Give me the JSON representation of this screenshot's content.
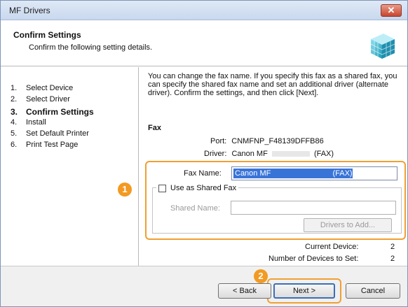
{
  "window": {
    "title": "MF Drivers",
    "close_glyph": "✕"
  },
  "header": {
    "title": "Confirm Settings",
    "subtitle": "Confirm the following setting details.",
    "icon": "printer-driver-icon"
  },
  "steps": [
    {
      "num": "1.",
      "label": "Select Device"
    },
    {
      "num": "2.",
      "label": "Select Driver"
    },
    {
      "num": "3.",
      "label": "Confirm Settings"
    },
    {
      "num": "4.",
      "label": "Install"
    },
    {
      "num": "5.",
      "label": "Set Default Printer"
    },
    {
      "num": "6.",
      "label": "Print Test Page"
    }
  ],
  "content": {
    "description": "You can change the fax name. If you specify this fax as a shared fax, you can specify the shared fax name and set an additional driver (alternate driver). Confirm the settings, and then click [Next].",
    "fax_heading": "Fax",
    "port_label": "Port:",
    "port_value": "CNMFNP_F48139DFFB86",
    "driver_label": "Driver:",
    "driver_value_prefix": "Canon MF",
    "driver_value_suffix": "(FAX)",
    "fax_name_label": "Fax Name:",
    "fax_name_value_prefix": "Canon MF",
    "fax_name_value_suffix": "(FAX)",
    "shared_checkbox_label": "Use as Shared Fax",
    "shared_name_label": "Shared Name:",
    "drivers_button": "Drivers to Add...",
    "current_device_label": "Current Device:",
    "current_device_value": "2",
    "num_devices_label": "Number of Devices to Set:",
    "num_devices_value": "2"
  },
  "callouts": {
    "one": "1",
    "two": "2"
  },
  "buttons": {
    "back": "< Back",
    "next": "Next >",
    "cancel": "Cancel"
  },
  "colors": {
    "highlight": "#f0a032",
    "badge": "#f29a22",
    "selection": "#3874d8"
  }
}
